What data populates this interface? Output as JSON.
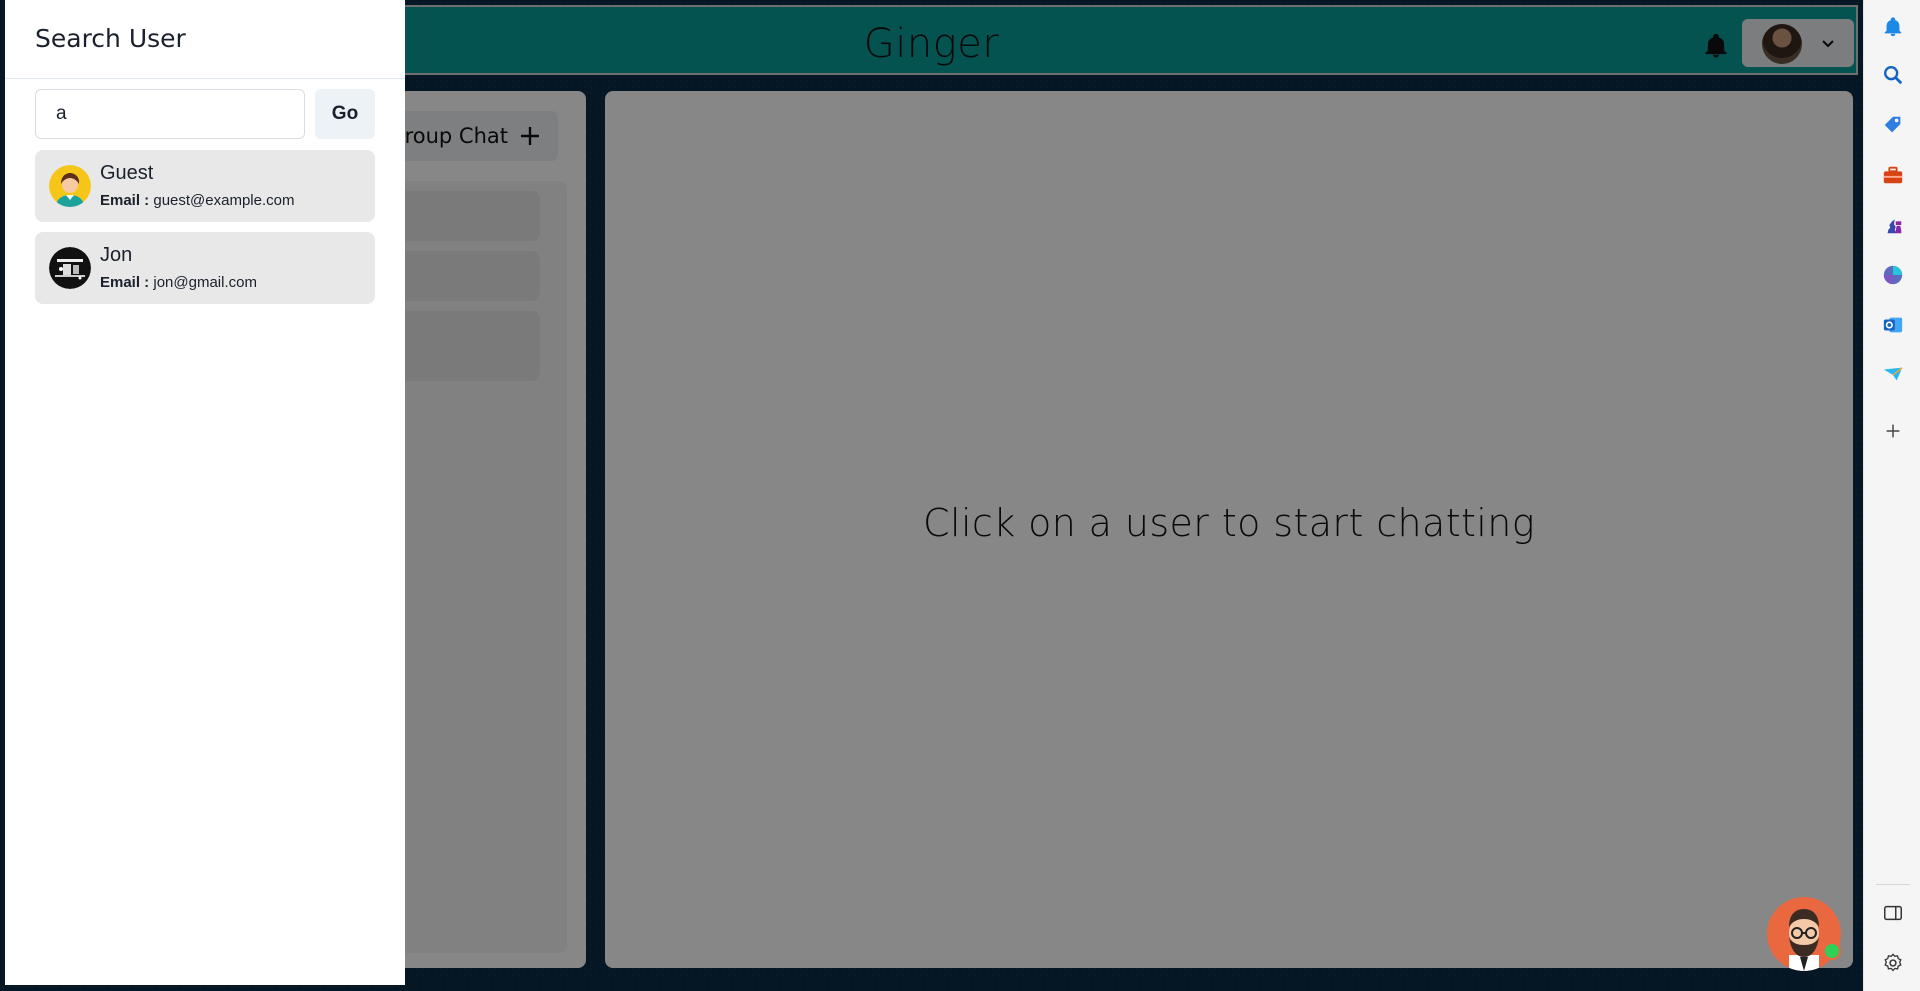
{
  "app": {
    "title": "Ginger",
    "group_chat_label": "roup Chat",
    "empty_state": "Click on a user to start chatting"
  },
  "drawer": {
    "title": "Search User",
    "search_value": "a",
    "go_label": "Go",
    "results": [
      {
        "name": "Guest",
        "email_label": "Email :",
        "email": "guest@example.com",
        "avatar": "guest-avatar"
      },
      {
        "name": "Jon",
        "email_label": "Email :",
        "email": "jon@gmail.com",
        "avatar": "jon-avatar"
      }
    ]
  },
  "edge_sidebar": {
    "icons": [
      "bell-icon",
      "search-icon",
      "tag-icon",
      "toolbox-icon",
      "chess-icon",
      "copilot-icon",
      "outlook-icon",
      "send-icon",
      "plus-icon",
      "sidebar-toggle-icon",
      "settings-icon"
    ]
  },
  "colors": {
    "topbar": "#0a9e9a",
    "overlay": "rgba(0,0,0,0.47)",
    "result_bg": "#e8e8e8",
    "online": "#2fcf5a"
  }
}
